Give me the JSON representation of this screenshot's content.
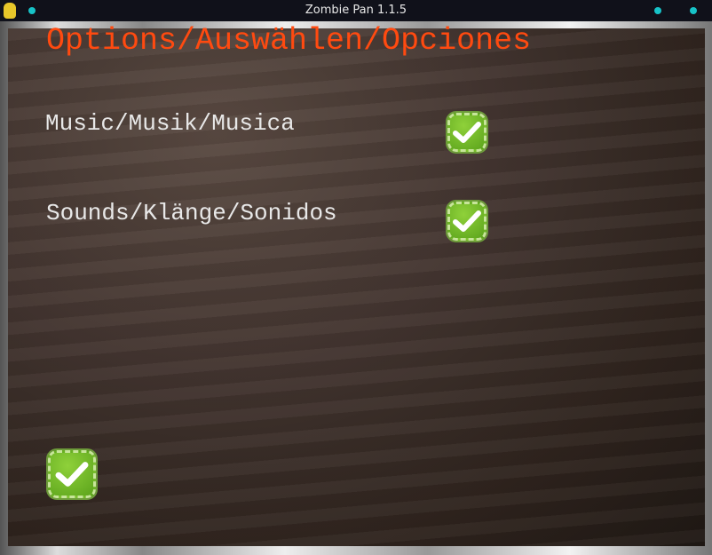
{
  "window": {
    "title": "Zombie Pan 1.1.5"
  },
  "heading": "Options/Auswählen/Opciones",
  "options": [
    {
      "label": "Music/Musik/Musica",
      "checked": true
    },
    {
      "label": "Sounds/Klänge/Sonidos",
      "checked": true
    }
  ],
  "confirm": {
    "icon": "checkmark-icon"
  },
  "colors": {
    "heading": "#ff4a10",
    "checkbox": "#6cb92a"
  }
}
